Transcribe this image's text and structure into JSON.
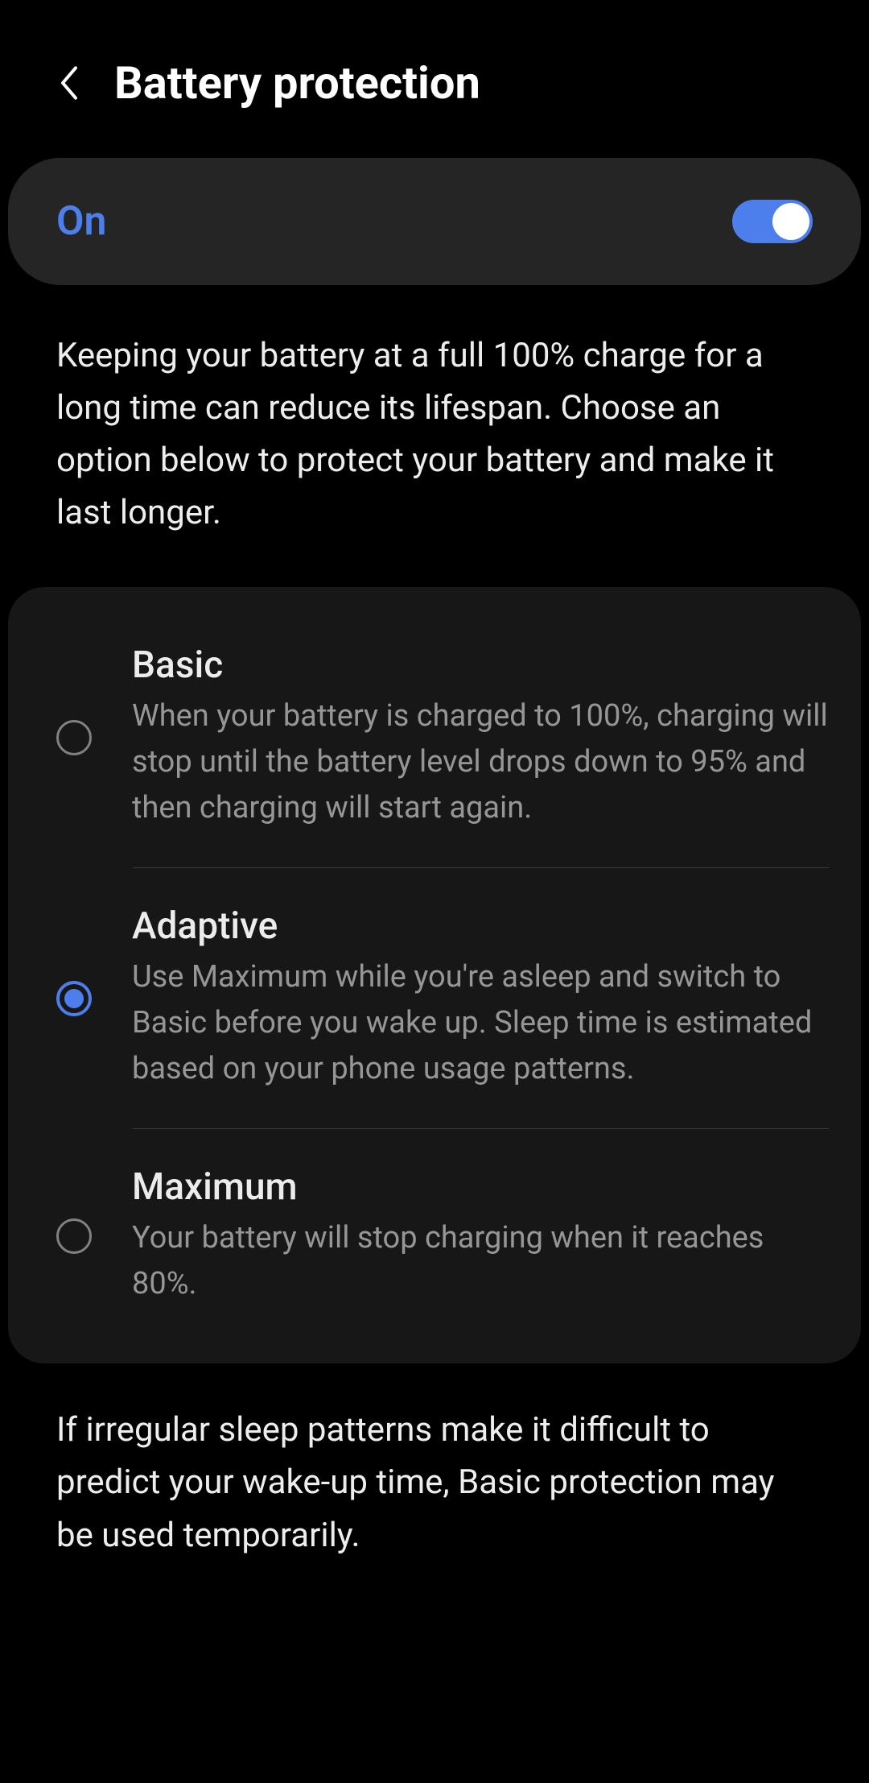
{
  "header": {
    "title": "Battery protection"
  },
  "toggle": {
    "label": "On",
    "enabled": true
  },
  "description": "Keeping your battery at a full 100% charge for a long time can reduce its lifespan. Choose an option below to protect your battery and make it last longer.",
  "options": [
    {
      "title": "Basic",
      "description": "When your battery is charged to 100%, charging will stop until the battery level drops down to 95% and then charging will start again.",
      "selected": false
    },
    {
      "title": "Adaptive",
      "description": "Use Maximum while you're asleep and switch to Basic before you wake up. Sleep time is estimated based on your phone usage patterns.",
      "selected": true
    },
    {
      "title": "Maximum",
      "description": "Your battery will stop charging when it reaches 80%.",
      "selected": false
    }
  ],
  "footer_note": "If irregular sleep patterns make it difficult to predict your wake-up time, Basic protection may be used temporarily.",
  "colors": {
    "accent": "#4d7fec",
    "background": "#000000",
    "card": "#252525",
    "options_card": "#171717"
  }
}
